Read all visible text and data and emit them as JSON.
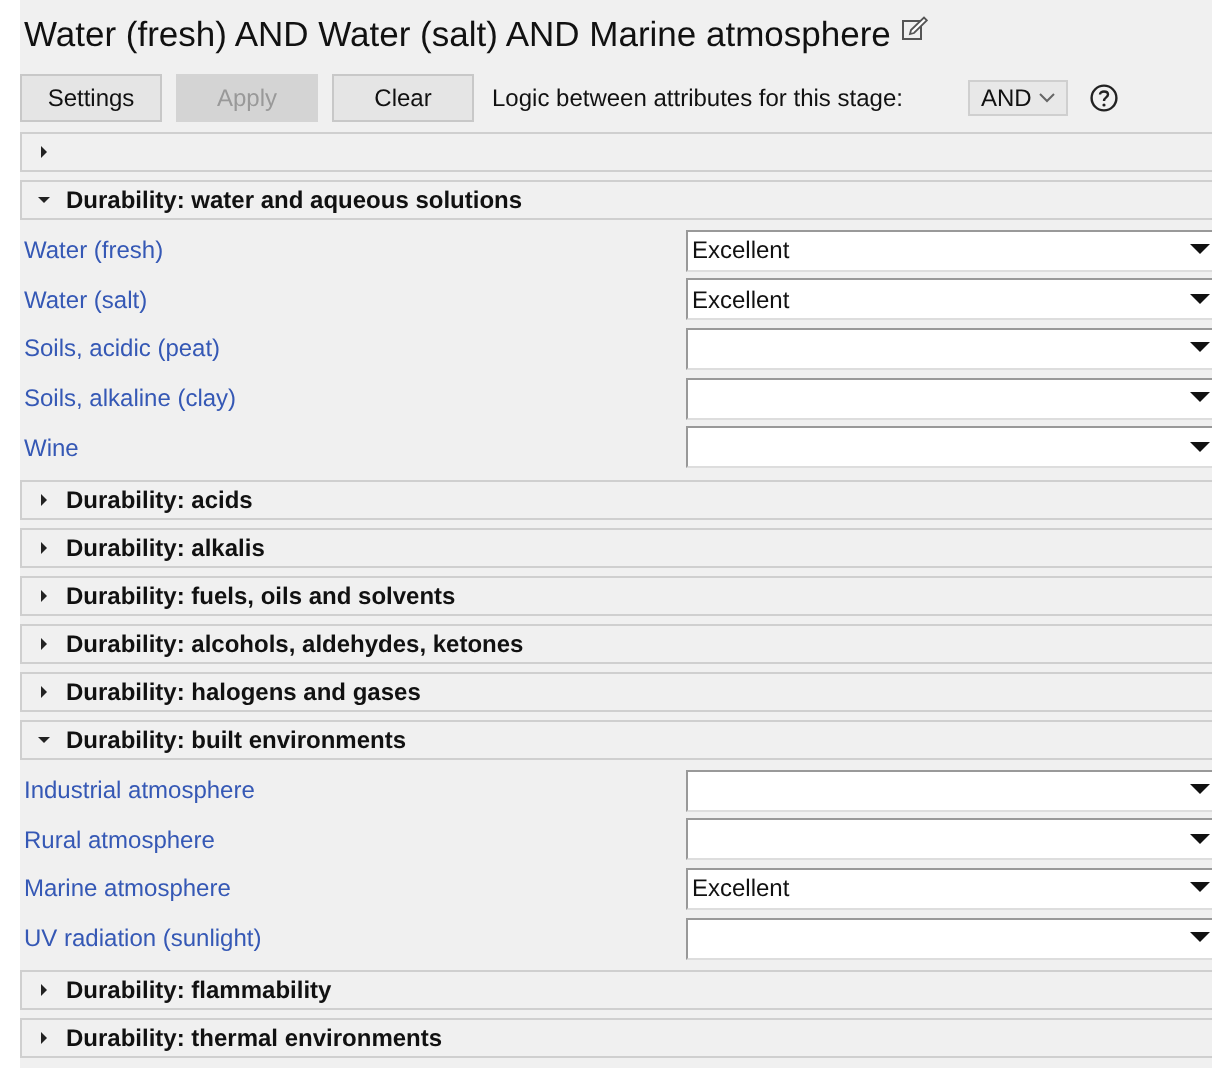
{
  "title": "Water (fresh) AND Water (salt) AND Marine atmosphere",
  "toolbar": {
    "buttons": [
      {
        "label": "Settings",
        "disabled": false
      },
      {
        "label": "Apply",
        "disabled": true
      },
      {
        "label": "Clear",
        "disabled": false
      }
    ],
    "logic_label": "Logic between attributes for this stage:",
    "logic_value": "AND"
  },
  "sections": [
    {
      "expanded": false
    },
    {
      "title": "Durability: water and aqueous solutions",
      "expanded": true,
      "rows": [
        {
          "label": "Water (fresh)",
          "value": "Excellent"
        },
        {
          "label": "Water (salt)",
          "value": "Excellent"
        },
        {
          "label": "Soils, acidic (peat)"
        },
        {
          "label": "Soils, alkaline (clay)"
        },
        {
          "label": "Wine"
        }
      ]
    },
    {
      "title": "Durability: acids",
      "expanded": false
    },
    {
      "title": "Durability: alkalis",
      "expanded": false
    },
    {
      "title": "Durability: fuels, oils and solvents",
      "expanded": false
    },
    {
      "title": "Durability: alcohols, aldehydes, ketones",
      "expanded": false
    },
    {
      "title": "Durability: halogens and gases",
      "expanded": false
    },
    {
      "title": "Durability: built environments",
      "expanded": true,
      "rows": [
        {
          "label": "Industrial atmosphere"
        },
        {
          "label": "Rural atmosphere"
        },
        {
          "label": "Marine atmosphere",
          "value": "Excellent"
        },
        {
          "label": "UV radiation (sunlight)"
        }
      ]
    },
    {
      "title": "Durability: flammability",
      "expanded": false
    },
    {
      "title": "Durability: thermal environments",
      "expanded": false
    }
  ]
}
